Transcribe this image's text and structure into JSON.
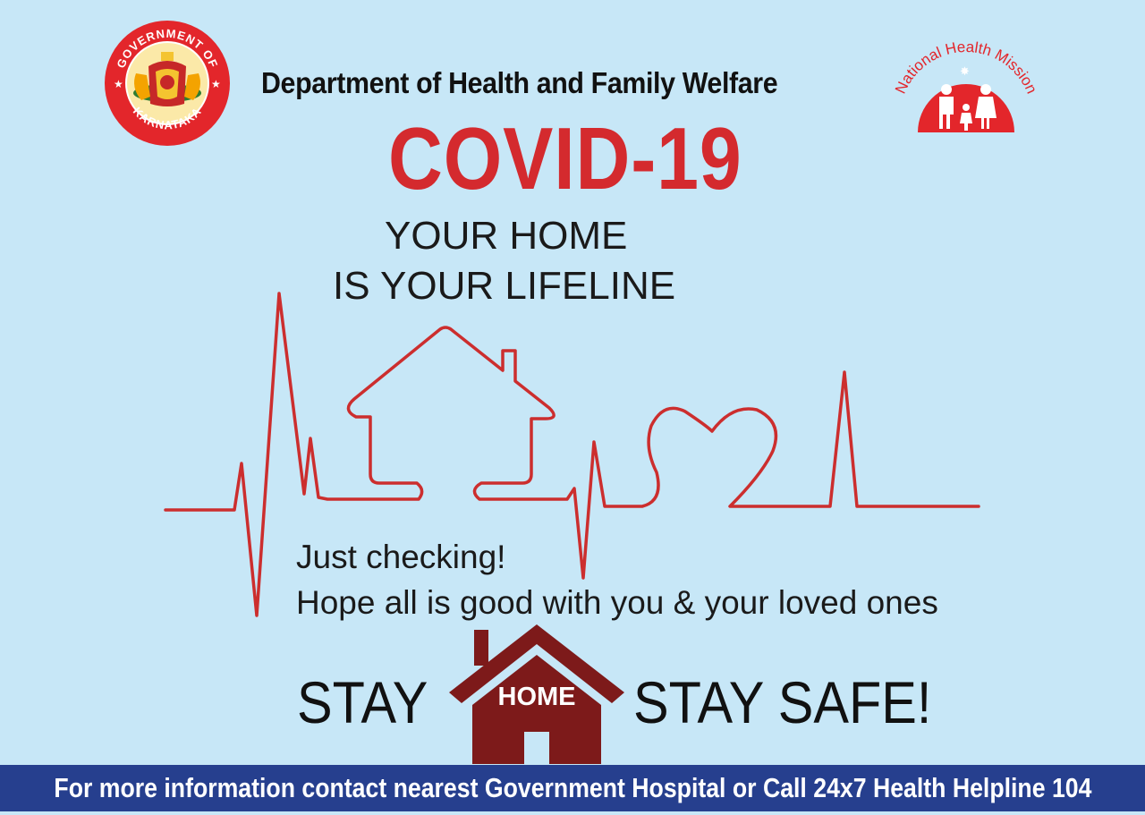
{
  "header": {
    "department": "Department of Health and Family Welfare",
    "seal_text_top": "GOVERNMENT OF",
    "seal_text_bottom": "KARNATAKA",
    "nhm_text": "National Health Mission"
  },
  "headline": {
    "title": "COVID-19",
    "tagline_line1": "YOUR HOME",
    "tagline_line2": "IS YOUR LIFELINE"
  },
  "message": {
    "line1": "Just checking!",
    "line2": "Hope all is good with you & your loved ones"
  },
  "slogan": {
    "left": "STAY",
    "house_label": "HOME",
    "right": "STAY SAFE!"
  },
  "footer": {
    "text": "For more information contact nearest Government Hospital or Call 24x7 Health Helpline 104"
  },
  "colors": {
    "background": "#c7e7f7",
    "accent_red": "#d42a2e",
    "house_maroon": "#8b1a1a",
    "footer_blue": "#263f8e"
  },
  "icons": [
    "karnataka-seal-icon",
    "nhm-logo-icon",
    "ecg-house-heart-line",
    "house-icon"
  ]
}
